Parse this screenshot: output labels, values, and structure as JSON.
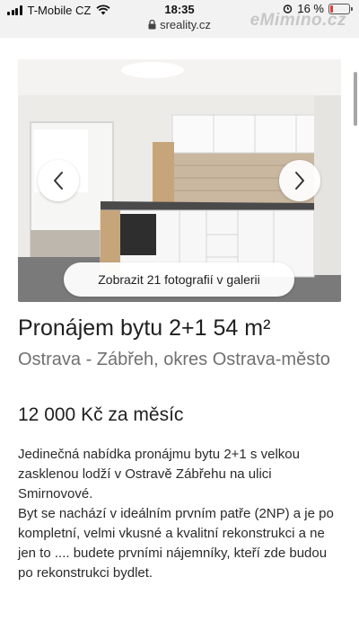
{
  "status_bar": {
    "carrier": "T-Mobile CZ",
    "time": "18:35",
    "battery": "16 %",
    "battery_level": 0.16
  },
  "browser": {
    "url": "sreality.cz",
    "watermark": "eMimino.cz"
  },
  "gallery": {
    "button_label": "Zobrazit 21 fotografií v galerii",
    "prev_icon": "chevron-left-icon",
    "next_icon": "chevron-right-icon"
  },
  "listing": {
    "title": "Pronájem bytu 2+1 54 m²",
    "location": "Ostrava - Zábřeh, okres Ostrava-město",
    "price": "12 000 Kč za měsíc",
    "description_1": "Jedinečná nabídka pronájmu bytu 2+1 s velkou zasklenou lodží v Ostravě Zábřehu na ulici Smirnovové.",
    "description_2": "Byt se nachází v ideálním prvním patře (2NP) a je po kompletní, velmi vkusné a kvalitní rekonstrukci a ne jen to .... budete prvními nájemníky, kteří zde budou po rekonstrukci bydlet."
  }
}
